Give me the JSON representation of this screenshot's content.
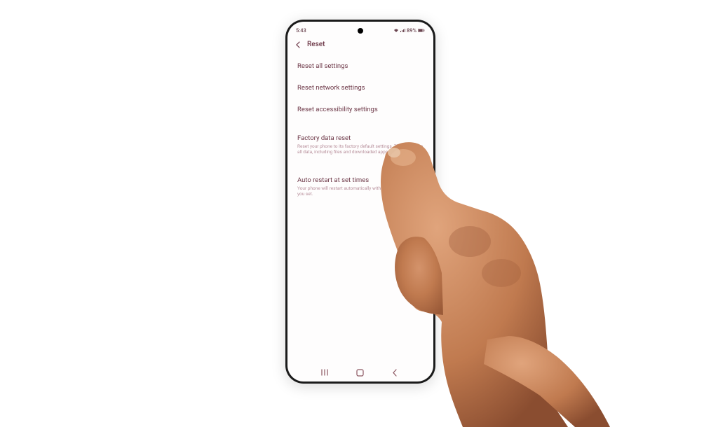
{
  "status_bar": {
    "time": "5:43",
    "battery_percent": "89%"
  },
  "header": {
    "title": "Reset"
  },
  "options": [
    {
      "title": "Reset all settings",
      "subtitle": ""
    },
    {
      "title": "Reset network settings",
      "subtitle": ""
    },
    {
      "title": "Reset accessibility settings",
      "subtitle": ""
    },
    {
      "title": "Factory data reset",
      "subtitle": "Reset your phone to its factory default settings. This will erase all data, including files and downloaded apps."
    },
    {
      "title": "Auto restart at set times",
      "subtitle": "Your phone will restart automatically within 1 hour of the time you set."
    }
  ]
}
